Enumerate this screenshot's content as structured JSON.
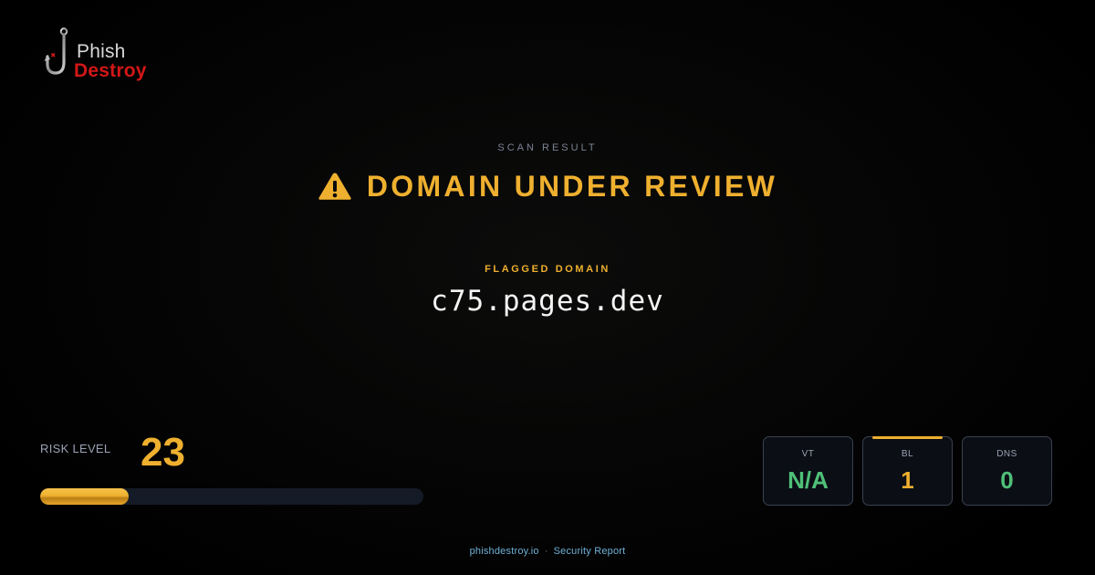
{
  "brand": {
    "line1": "Phish",
    "line2": "Destroy",
    "icon": "fishhook-icon"
  },
  "scan": {
    "label": "SCAN RESULT",
    "status_icon": "warning-triangle-icon",
    "status_title": "DOMAIN UNDER REVIEW",
    "status_color": "#efb02f"
  },
  "flagged": {
    "label": "FLAGGED DOMAIN",
    "domain": "c75.pages.dev"
  },
  "risk": {
    "label": "RISK LEVEL",
    "score": "23",
    "max": 100
  },
  "stats": [
    {
      "label": "VT",
      "value": "N/A",
      "color": "#4fbf78",
      "highlight": false
    },
    {
      "label": "BL",
      "value": "1",
      "color": "#efb02f",
      "highlight": true
    },
    {
      "label": "DNS",
      "value": "0",
      "color": "#4fbf78",
      "highlight": false
    }
  ],
  "footer": {
    "site": "phishdestroy.io",
    "separator": "·",
    "label": "Security Report"
  }
}
